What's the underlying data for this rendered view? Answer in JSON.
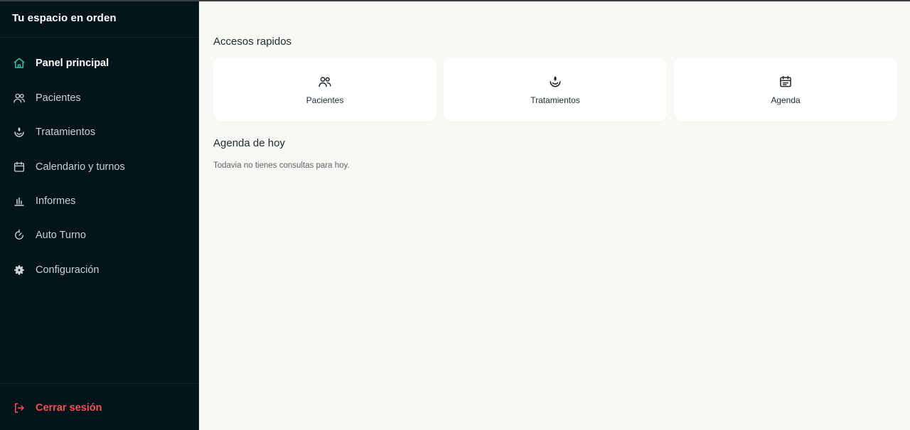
{
  "app": {
    "brand": "Tu espacio en orden"
  },
  "sidebar": {
    "items": [
      {
        "label": "Panel principal",
        "icon": "home-icon",
        "active": true
      },
      {
        "label": "Pacientes",
        "icon": "users-icon",
        "active": false
      },
      {
        "label": "Tratamientos",
        "icon": "sprout-icon",
        "active": false
      },
      {
        "label": "Calendario y turnos",
        "icon": "calendar-icon",
        "active": false
      },
      {
        "label": "Informes",
        "icon": "bar-chart-icon",
        "active": false
      },
      {
        "label": "Auto Turno",
        "icon": "refresh-icon",
        "active": false
      },
      {
        "label": "Configuración",
        "icon": "gear-icon",
        "active": false
      }
    ],
    "logout": {
      "label": "Cerrar sesión",
      "icon": "logout-icon"
    }
  },
  "main": {
    "quick_access_title": "Accesos rapidos",
    "quick_access": [
      {
        "label": "Pacientes",
        "icon": "users-icon"
      },
      {
        "label": "Tratamientos",
        "icon": "sprout-icon"
      },
      {
        "label": "Agenda",
        "icon": "calendar-icon"
      }
    ],
    "agenda_title": "Agenda de hoy",
    "agenda_empty": "Todavia no tienes consultas para hoy."
  },
  "colors": {
    "sidebar_bg": "#03141b",
    "active_icon": "#2fc4a0",
    "logout": "#ef5353",
    "main_bg": "#f8f8f4"
  }
}
